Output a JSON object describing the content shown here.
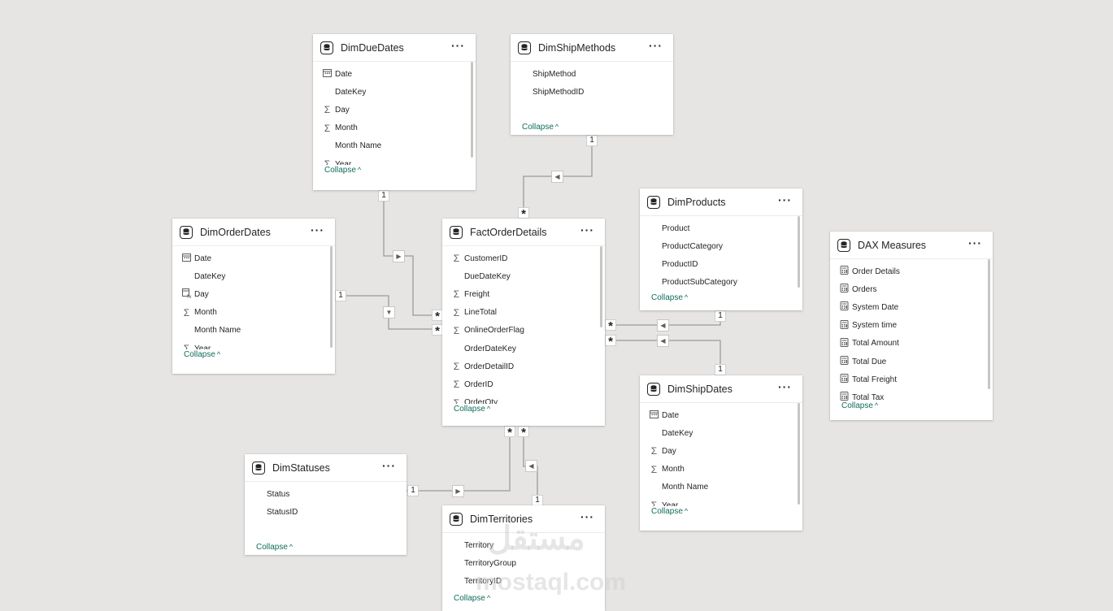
{
  "tables": {
    "dimDueDates": {
      "title": "DimDueDates",
      "fields": [
        {
          "name": "Date",
          "icon": "calendar-icon"
        },
        {
          "name": "DateKey",
          "icon": ""
        },
        {
          "name": "Day",
          "icon": "sigma-icon"
        },
        {
          "name": "Month",
          "icon": "sigma-icon"
        },
        {
          "name": "Month Name",
          "icon": ""
        },
        {
          "name": "Year",
          "icon": "sigma-icon"
        }
      ],
      "collapse": "Collapse"
    },
    "dimShipMethods": {
      "title": "DimShipMethods",
      "fields": [
        {
          "name": "ShipMethod",
          "icon": ""
        },
        {
          "name": "ShipMethodID",
          "icon": ""
        }
      ],
      "collapse": "Collapse"
    },
    "dimProducts": {
      "title": "DimProducts",
      "fields": [
        {
          "name": "Product",
          "icon": ""
        },
        {
          "name": "ProductCategory",
          "icon": ""
        },
        {
          "name": "ProductID",
          "icon": ""
        },
        {
          "name": "ProductSubCategory",
          "icon": ""
        }
      ],
      "collapse": "Collapse"
    },
    "dimOrderDates": {
      "title": "DimOrderDates",
      "fields": [
        {
          "name": "Date",
          "icon": "calendar-icon"
        },
        {
          "name": "DateKey",
          "icon": ""
        },
        {
          "name": "Day",
          "icon": "calc-column-icon"
        },
        {
          "name": "Month",
          "icon": "sigma-icon"
        },
        {
          "name": "Month Name",
          "icon": ""
        },
        {
          "name": "Year",
          "icon": "sigma-icon"
        }
      ],
      "collapse": "Collapse"
    },
    "factOrderDetails": {
      "title": "FactOrderDetails",
      "fields": [
        {
          "name": "CustomerID",
          "icon": "sigma-icon"
        },
        {
          "name": "DueDateKey",
          "icon": ""
        },
        {
          "name": "Freight",
          "icon": "sigma-icon"
        },
        {
          "name": "LineTotal",
          "icon": "sigma-icon"
        },
        {
          "name": "OnlineOrderFlag",
          "icon": "sigma-icon"
        },
        {
          "name": "OrderDateKey",
          "icon": ""
        },
        {
          "name": "OrderDetailID",
          "icon": "sigma-icon"
        },
        {
          "name": "OrderID",
          "icon": "sigma-icon"
        },
        {
          "name": "OrderQty",
          "icon": "sigma-icon"
        }
      ],
      "collapse": "Collapse"
    },
    "daxMeasures": {
      "title": "DAX Measures",
      "fields": [
        {
          "name": "Order Details",
          "icon": "measure-icon"
        },
        {
          "name": "Orders",
          "icon": "measure-icon"
        },
        {
          "name": "System Date",
          "icon": "measure-icon"
        },
        {
          "name": "System time",
          "icon": "measure-icon"
        },
        {
          "name": "Total Amount",
          "icon": "measure-icon"
        },
        {
          "name": "Total Due",
          "icon": "measure-icon"
        },
        {
          "name": "Total Freight",
          "icon": "measure-icon"
        },
        {
          "name": "Total Tax",
          "icon": "measure-icon"
        }
      ],
      "collapse": "Collapse"
    },
    "dimShipDates": {
      "title": "DimShipDates",
      "fields": [
        {
          "name": "Date",
          "icon": "calendar-icon"
        },
        {
          "name": "DateKey",
          "icon": ""
        },
        {
          "name": "Day",
          "icon": "sigma-icon"
        },
        {
          "name": "Month",
          "icon": "sigma-icon"
        },
        {
          "name": "Month Name",
          "icon": ""
        },
        {
          "name": "Year",
          "icon": "sigma-icon"
        }
      ],
      "collapse": "Collapse"
    },
    "dimStatuses": {
      "title": "DimStatuses",
      "fields": [
        {
          "name": "Status",
          "icon": ""
        },
        {
          "name": "StatusID",
          "icon": ""
        }
      ],
      "collapse": "Collapse"
    },
    "dimTerritories": {
      "title": "DimTerritories",
      "fields": [
        {
          "name": "Territory",
          "icon": ""
        },
        {
          "name": "TerritoryGroup",
          "icon": ""
        },
        {
          "name": "TerritoryID",
          "icon": ""
        }
      ],
      "collapse": "Collapse"
    }
  },
  "more_label": "···",
  "cardinality": {
    "one": "1",
    "many": "*"
  },
  "watermark": {
    "arabic": "مستقل",
    "latin": "mostaql.com"
  },
  "colors": {
    "canvas": "#e6e5e3",
    "line": "#8a8886",
    "collapse": "#0f6e5a"
  }
}
